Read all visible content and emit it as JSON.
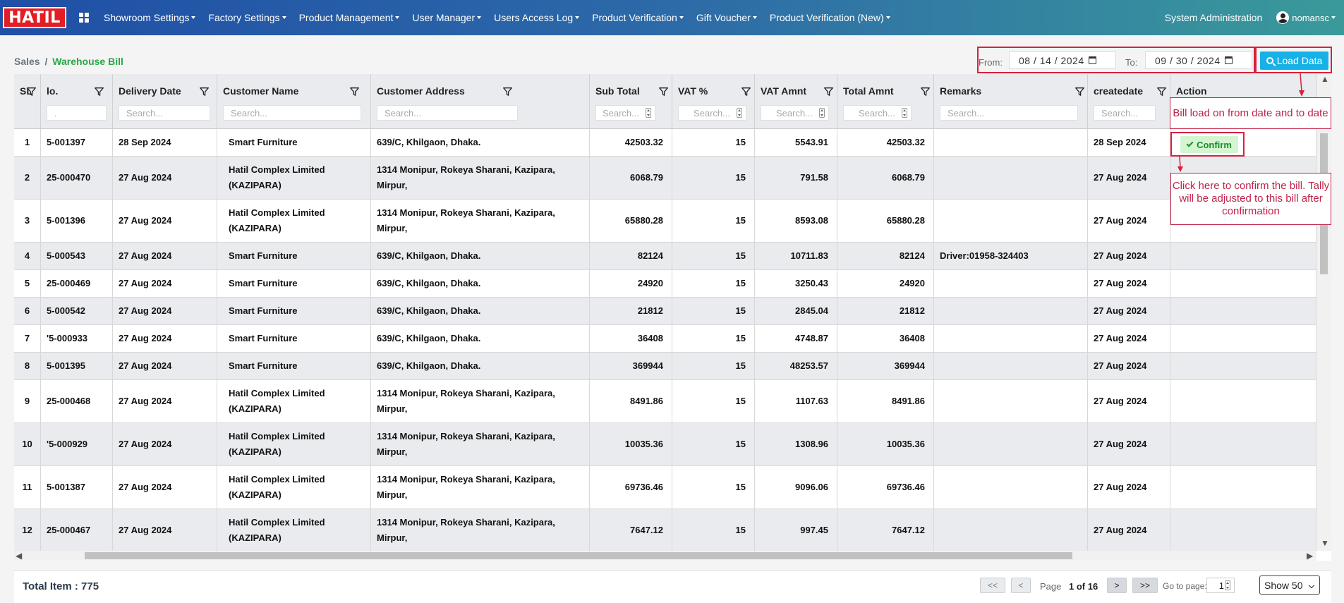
{
  "nav": {
    "logo": "HATIL",
    "menu": [
      {
        "label": "Showroom Settings"
      },
      {
        "label": "Factory Settings"
      },
      {
        "label": "Product Management"
      },
      {
        "label": "User Manager"
      },
      {
        "label": "Users Access Log"
      },
      {
        "label": "Product Verification"
      },
      {
        "label": "Gift Voucher"
      },
      {
        "label": "Product Verification (New)"
      }
    ],
    "system_admin": "System Administration",
    "user": "nomansc"
  },
  "breadcrumb": {
    "root": "Sales",
    "separator": "/",
    "current": "Warehouse Bill"
  },
  "filter": {
    "from_label": "From:",
    "from_value": "08 / 14 / 2024",
    "to_label": "To:",
    "to_value": "09 / 30 / 2024",
    "load_label": "Load Data"
  },
  "table": {
    "columns": [
      {
        "title": "SL",
        "search": ""
      },
      {
        "title": "lo.",
        "search": "."
      },
      {
        "title": "Delivery Date",
        "search": "Search..."
      },
      {
        "title": "Customer Name",
        "search": "Search..."
      },
      {
        "title": "Customer Address",
        "search": "Search..."
      },
      {
        "title": "Sub Total",
        "search": "Search..."
      },
      {
        "title": "VAT %",
        "search": "Search..."
      },
      {
        "title": "VAT Amnt",
        "search": "Search..."
      },
      {
        "title": "Total Amnt",
        "search": "Search..."
      },
      {
        "title": "Remarks",
        "search": "Search..."
      },
      {
        "title": "createdate",
        "search": "Search..."
      },
      {
        "title": "Action",
        "search": ""
      }
    ],
    "rows": [
      {
        "sl": "1",
        "no": "5-001397",
        "date": "28 Sep 2024",
        "name1": "Smart Furniture",
        "name2": "",
        "addr1": "639/C, Khilgaon, Dhaka.",
        "addr2": "",
        "sub": "42503.32",
        "vat": "15",
        "vatamt": "5543.91",
        "total": "42503.32",
        "remarks": "",
        "created": "28 Sep 2024"
      },
      {
        "sl": "2",
        "no": "25-000470",
        "date": "27 Aug 2024",
        "name1": "Hatil Complex Limited",
        "name2": "(KAZIPARA)",
        "addr1": "1314 Monipur, Rokeya Sharani, Kazipara,",
        "addr2": "Mirpur,",
        "sub": "6068.79",
        "vat": "15",
        "vatamt": "791.58",
        "total": "6068.79",
        "remarks": "",
        "created": "27 Aug 2024"
      },
      {
        "sl": "3",
        "no": "5-001396",
        "date": "27 Aug 2024",
        "name1": "Hatil Complex Limited",
        "name2": "(KAZIPARA)",
        "addr1": "1314 Monipur, Rokeya Sharani, Kazipara,",
        "addr2": "Mirpur,",
        "sub": "65880.28",
        "vat": "15",
        "vatamt": "8593.08",
        "total": "65880.28",
        "remarks": "",
        "created": "27 Aug 2024"
      },
      {
        "sl": "4",
        "no": "5-000543",
        "date": "27 Aug 2024",
        "name1": "Smart Furniture",
        "name2": "",
        "addr1": "639/C, Khilgaon, Dhaka.",
        "addr2": "",
        "sub": "82124",
        "vat": "15",
        "vatamt": "10711.83",
        "total": "82124",
        "remarks": "Driver:01958-324403",
        "created": "27 Aug 2024"
      },
      {
        "sl": "5",
        "no": "25-000469",
        "date": "27 Aug 2024",
        "name1": "Smart Furniture",
        "name2": "",
        "addr1": "639/C, Khilgaon, Dhaka.",
        "addr2": "",
        "sub": "24920",
        "vat": "15",
        "vatamt": "3250.43",
        "total": "24920",
        "remarks": "",
        "created": "27 Aug 2024"
      },
      {
        "sl": "6",
        "no": "5-000542",
        "date": "27 Aug 2024",
        "name1": "Smart Furniture",
        "name2": "",
        "addr1": "639/C, Khilgaon, Dhaka.",
        "addr2": "",
        "sub": "21812",
        "vat": "15",
        "vatamt": "2845.04",
        "total": "21812",
        "remarks": "",
        "created": "27 Aug 2024"
      },
      {
        "sl": "7",
        "no": "'5-000933",
        "date": "27 Aug 2024",
        "name1": "Smart Furniture",
        "name2": "",
        "addr1": "639/C, Khilgaon, Dhaka.",
        "addr2": "",
        "sub": "36408",
        "vat": "15",
        "vatamt": "4748.87",
        "total": "36408",
        "remarks": "",
        "created": "27 Aug 2024"
      },
      {
        "sl": "8",
        "no": "5-001395",
        "date": "27 Aug 2024",
        "name1": "Smart Furniture",
        "name2": "",
        "addr1": "639/C, Khilgaon, Dhaka.",
        "addr2": "",
        "sub": "369944",
        "vat": "15",
        "vatamt": "48253.57",
        "total": "369944",
        "remarks": "",
        "created": "27 Aug 2024"
      },
      {
        "sl": "9",
        "no": "25-000468",
        "date": "27 Aug 2024",
        "name1": "Hatil Complex Limited",
        "name2": "(KAZIPARA)",
        "addr1": "1314 Monipur, Rokeya Sharani, Kazipara,",
        "addr2": "Mirpur,",
        "sub": "8491.86",
        "vat": "15",
        "vatamt": "1107.63",
        "total": "8491.86",
        "remarks": "",
        "created": "27 Aug 2024"
      },
      {
        "sl": "10",
        "no": "'5-000929",
        "date": "27 Aug 2024",
        "name1": "Hatil Complex Limited",
        "name2": "(KAZIPARA)",
        "addr1": "1314 Monipur, Rokeya Sharani, Kazipara,",
        "addr2": "Mirpur,",
        "sub": "10035.36",
        "vat": "15",
        "vatamt": "1308.96",
        "total": "10035.36",
        "remarks": "",
        "created": "27 Aug 2024"
      },
      {
        "sl": "11",
        "no": "5-001387",
        "date": "27 Aug 2024",
        "name1": "Hatil Complex Limited",
        "name2": "(KAZIPARA)",
        "addr1": "1314 Monipur, Rokeya Sharani, Kazipara,",
        "addr2": "Mirpur,",
        "sub": "69736.46",
        "vat": "15",
        "vatamt": "9096.06",
        "total": "69736.46",
        "remarks": "",
        "created": "27 Aug 2024"
      },
      {
        "sl": "12",
        "no": "25-000467",
        "date": "27 Aug 2024",
        "name1": "Hatil Complex Limited",
        "name2": "(KAZIPARA)",
        "addr1": "1314 Monipur, Rokeya Sharani, Kazipara,",
        "addr2": "Mirpur,",
        "sub": "7647.12",
        "vat": "15",
        "vatamt": "997.45",
        "total": "7647.12",
        "remarks": "",
        "created": "27 Aug 2024"
      }
    ],
    "confirm_label": "Confirm"
  },
  "annotations": {
    "load_note": "Bill load on from date and to date",
    "confirm_note": "Click here to confirm the bill. Tally will be adjusted to this bill after confirmation"
  },
  "footer": {
    "total_label": "Total Item : 775",
    "first": "<<",
    "prev": "<",
    "page_label": "Page",
    "page_value": "1 of 16",
    "next": ">",
    "last": ">>",
    "goto_label": "Go to page:",
    "goto_value": "1",
    "show_value": "Show 50"
  },
  "colors": {
    "nav_start": "#1f4fa6",
    "nav_end": "#3a9a9a",
    "accent_green": "#28a745",
    "load_btn": "#17b1e8",
    "annotation_red": "#d6213c",
    "brand_red": "#e21d23"
  }
}
